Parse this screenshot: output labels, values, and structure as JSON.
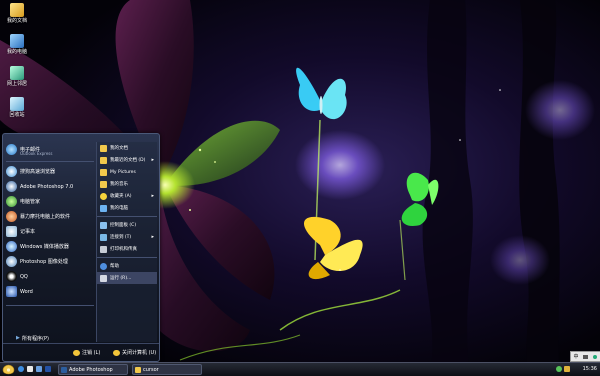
{
  "desktop_icons": [
    {
      "label": "我的文档",
      "icon": "documents-icon"
    },
    {
      "label": "我的电脑",
      "icon": "computer-icon"
    },
    {
      "label": "网上邻居",
      "icon": "network-icon"
    },
    {
      "label": "回收站",
      "icon": "recycle-bin-icon"
    }
  ],
  "start_menu": {
    "left_items": [
      {
        "label": "电子邮件",
        "sub": "Outlook Express"
      },
      {
        "label": "搜狗高速浏览器"
      },
      {
        "label": "Adobe Photoshop 7.0"
      },
      {
        "label": "电脑管家"
      },
      {
        "label": "暴力摩托电脑上的软件"
      },
      {
        "label": "记事本"
      },
      {
        "label": "Windows 媒体播放器"
      },
      {
        "label": "Photoshop 图像处理"
      },
      {
        "label": "QQ"
      },
      {
        "label": "Word"
      }
    ],
    "all_programs": "所有程序(P)",
    "right_items": [
      {
        "label": "我的文档"
      },
      {
        "label": "我最近的文档 (D)",
        "arrow": "▸"
      },
      {
        "label": "My Pictures"
      },
      {
        "label": "我的音乐"
      },
      {
        "label": "收藏夹 (A)",
        "arrow": "▸"
      },
      {
        "label": "我的电脑"
      },
      {
        "label": "控制面板 (C)"
      },
      {
        "label": "连接到 (T)",
        "arrow": "▸"
      },
      {
        "label": "打印机和传真"
      },
      {
        "label": "帮助"
      },
      {
        "label": "运行 (R)..."
      }
    ],
    "footer": {
      "logoff": "注销 (L)",
      "shutdown": "关闭计算机 (U)"
    }
  },
  "taskbar": {
    "tasks": [
      {
        "label": "Adobe Photoshop"
      },
      {
        "label": "cursor"
      }
    ],
    "clock": "15:36"
  },
  "langbar": {
    "label": "中"
  }
}
